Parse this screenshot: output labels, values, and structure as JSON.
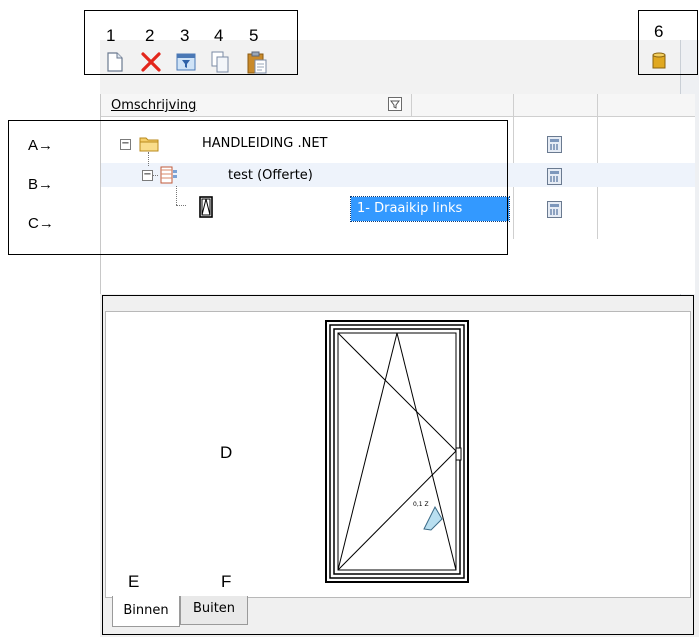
{
  "callouts": {
    "toolbar_numbers": [
      "1",
      "2",
      "3",
      "4",
      "5"
    ],
    "right_number": "6",
    "row_letters": [
      "A→",
      "B→",
      "C→"
    ],
    "preview_letter": "D",
    "tab_letters": [
      "E",
      "F"
    ]
  },
  "toolbar": {
    "icons": [
      "new-document-icon",
      "delete-icon",
      "filter-icon",
      "copy-icon",
      "paste-icon"
    ],
    "right_icon": "database-icon"
  },
  "grid": {
    "column_header": "Omschrijving",
    "rows": [
      {
        "level": 0,
        "label": "HANDLEIDING .NET",
        "icon": "folder-icon",
        "toggle": "−"
      },
      {
        "level": 1,
        "label": "test (Offerte)",
        "icon": "quote-document-icon",
        "toggle": "−"
      },
      {
        "level": 2,
        "label": "1- Draaikip links",
        "icon": "window-element-icon",
        "selected": true
      }
    ]
  },
  "preview": {
    "tabs": [
      "Binnen",
      "Buiten"
    ],
    "active_tab": "Binnen"
  },
  "colors": {
    "selection": "#3399ff",
    "row_highlight": "#eef3fb",
    "delete_red": "#e3261b"
  }
}
